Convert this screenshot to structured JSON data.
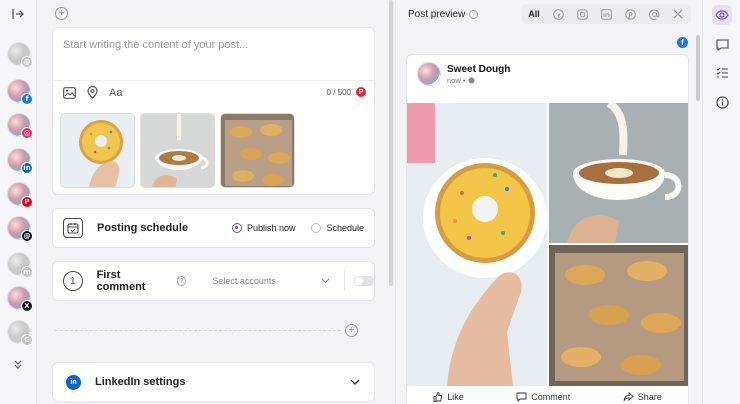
{
  "composer": {
    "placeholder": "Start writing the content of your post...",
    "char_count": "0 / 500",
    "format_label": "Aa"
  },
  "schedule": {
    "title": "Posting schedule",
    "publish_now": "Publish now",
    "schedule": "Schedule",
    "selected": "publish_now"
  },
  "first_comment": {
    "title": "First comment",
    "select_placeholder": "Select accounts",
    "enabled": false
  },
  "linkedin": {
    "title": "LinkedIn settings"
  },
  "accounts": [
    {
      "network": "threads",
      "badge": "@",
      "color": "#9a9aa0",
      "active": false
    },
    {
      "network": "facebook",
      "badge": "f",
      "color": "#1877f2",
      "active": true
    },
    {
      "network": "instagram",
      "badge": "◎",
      "color": "#e1306c",
      "active": true
    },
    {
      "network": "linkedin",
      "badge": "in",
      "color": "#0a66c2",
      "active": true
    },
    {
      "network": "pinterest",
      "badge": "P",
      "color": "#e60023",
      "active": true
    },
    {
      "network": "threads",
      "badge": "@",
      "color": "#111111",
      "active": true
    },
    {
      "network": "mastodon",
      "badge": "m",
      "color": "#9a9aa0",
      "active": false
    },
    {
      "network": "x",
      "badge": "X",
      "color": "#111111",
      "active": true
    },
    {
      "network": "google",
      "badge": "G",
      "color": "#9a9aa0",
      "active": false
    }
  ],
  "preview": {
    "title": "Post preview",
    "tabs": [
      "All",
      "facebook",
      "instagram",
      "linkedin",
      "pinterest",
      "threads",
      "x"
    ],
    "active_tab": "All",
    "author": "Sweet Dough",
    "meta": "now •",
    "actions": {
      "like": "Like",
      "comment": "Comment",
      "share": "Share"
    }
  },
  "colors": {
    "accent": "#6b4fbb",
    "facebook": "#1877f2"
  }
}
